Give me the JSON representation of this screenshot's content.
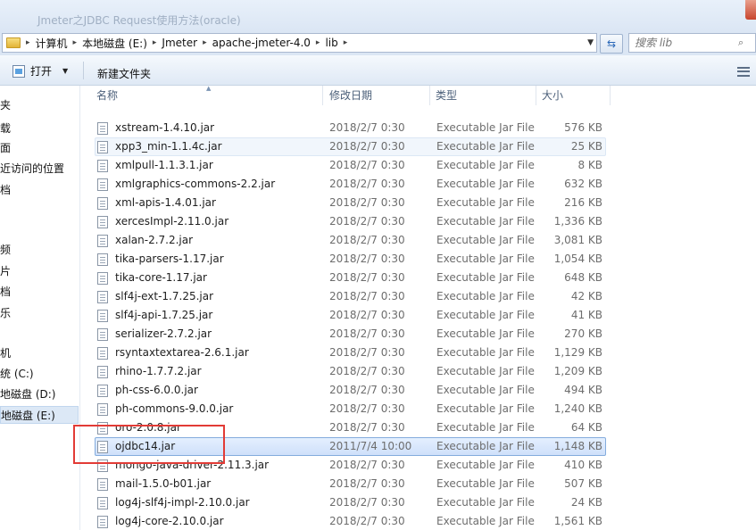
{
  "title_strip": {
    "text": "Jmeter之JDBC Request使用方法(oracle)"
  },
  "address": {
    "crumbs": [
      "计算机",
      "本地磁盘 (E:)",
      "Jmeter",
      "apache-jmeter-4.0",
      "lib"
    ]
  },
  "search": {
    "placeholder": "搜索 lib"
  },
  "toolbar": {
    "open_label": "打开",
    "new_folder_label": "新建文件夹"
  },
  "nav": {
    "items": [
      {
        "label": "夹"
      },
      {
        "label": "载"
      },
      {
        "label": "面"
      },
      {
        "label": "近访问的位置"
      },
      {
        "label": "档"
      },
      {
        "label": "频"
      },
      {
        "label": "片"
      },
      {
        "label": "档"
      },
      {
        "label": "乐"
      },
      {
        "label": "机"
      },
      {
        "label": "统 (C:)"
      },
      {
        "label": "地磁盘 (D:)"
      },
      {
        "label": "地磁盘 (E:)"
      }
    ]
  },
  "columns": {
    "name": "名称",
    "date": "修改日期",
    "type": "类型",
    "size": "大小"
  },
  "files": [
    {
      "name": "xstream-1.4.10.jar",
      "date": "2018/2/7 0:30",
      "type": "Executable Jar File",
      "size": "576 KB"
    },
    {
      "name": "xpp3_min-1.1.4c.jar",
      "date": "2018/2/7 0:30",
      "type": "Executable Jar File",
      "size": "25 KB"
    },
    {
      "name": "xmlpull-1.1.3.1.jar",
      "date": "2018/2/7 0:30",
      "type": "Executable Jar File",
      "size": "8 KB"
    },
    {
      "name": "xmlgraphics-commons-2.2.jar",
      "date": "2018/2/7 0:30",
      "type": "Executable Jar File",
      "size": "632 KB"
    },
    {
      "name": "xml-apis-1.4.01.jar",
      "date": "2018/2/7 0:30",
      "type": "Executable Jar File",
      "size": "216 KB"
    },
    {
      "name": "xercesImpl-2.11.0.jar",
      "date": "2018/2/7 0:30",
      "type": "Executable Jar File",
      "size": "1,336 KB"
    },
    {
      "name": "xalan-2.7.2.jar",
      "date": "2018/2/7 0:30",
      "type": "Executable Jar File",
      "size": "3,081 KB"
    },
    {
      "name": "tika-parsers-1.17.jar",
      "date": "2018/2/7 0:30",
      "type": "Executable Jar File",
      "size": "1,054 KB"
    },
    {
      "name": "tika-core-1.17.jar",
      "date": "2018/2/7 0:30",
      "type": "Executable Jar File",
      "size": "648 KB"
    },
    {
      "name": "slf4j-ext-1.7.25.jar",
      "date": "2018/2/7 0:30",
      "type": "Executable Jar File",
      "size": "42 KB"
    },
    {
      "name": "slf4j-api-1.7.25.jar",
      "date": "2018/2/7 0:30",
      "type": "Executable Jar File",
      "size": "41 KB"
    },
    {
      "name": "serializer-2.7.2.jar",
      "date": "2018/2/7 0:30",
      "type": "Executable Jar File",
      "size": "270 KB"
    },
    {
      "name": "rsyntaxtextarea-2.6.1.jar",
      "date": "2018/2/7 0:30",
      "type": "Executable Jar File",
      "size": "1,129 KB"
    },
    {
      "name": "rhino-1.7.7.2.jar",
      "date": "2018/2/7 0:30",
      "type": "Executable Jar File",
      "size": "1,209 KB"
    },
    {
      "name": "ph-css-6.0.0.jar",
      "date": "2018/2/7 0:30",
      "type": "Executable Jar File",
      "size": "494 KB"
    },
    {
      "name": "ph-commons-9.0.0.jar",
      "date": "2018/2/7 0:30",
      "type": "Executable Jar File",
      "size": "1,240 KB"
    },
    {
      "name": "oro-2.0.8.jar",
      "date": "2018/2/7 0:30",
      "type": "Executable Jar File",
      "size": "64 KB"
    },
    {
      "name": "ojdbc14.jar",
      "date": "2011/7/4 10:00",
      "type": "Executable Jar File",
      "size": "1,148 KB"
    },
    {
      "name": "mongo-java-driver-2.11.3.jar",
      "date": "2018/2/7 0:30",
      "type": "Executable Jar File",
      "size": "410 KB"
    },
    {
      "name": "mail-1.5.0-b01.jar",
      "date": "2018/2/7 0:30",
      "type": "Executable Jar File",
      "size": "507 KB"
    },
    {
      "name": "log4j-slf4j-impl-2.10.0.jar",
      "date": "2018/2/7 0:30",
      "type": "Executable Jar File",
      "size": "24 KB"
    },
    {
      "name": "log4j-core-2.10.0.jar",
      "date": "2018/2/7 0:30",
      "type": "Executable Jar File",
      "size": "1,561 KB"
    }
  ],
  "selection": {
    "hover_row": 1,
    "selected_row": 17
  },
  "colors": {
    "annotation": "#e23b36",
    "selection": "#cfe0fa",
    "selection_border": "#84acdd"
  }
}
